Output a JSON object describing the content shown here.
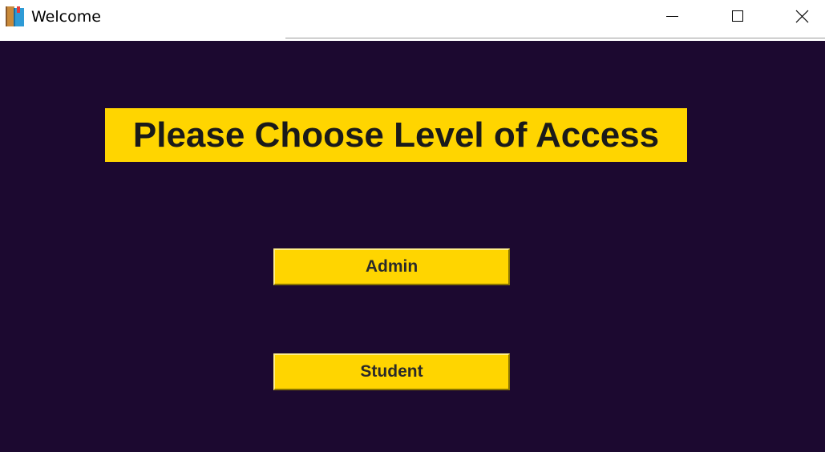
{
  "window": {
    "title": "Welcome",
    "icon": "book-app-icon",
    "controls": [
      "minimize-icon",
      "maximize-icon",
      "close-icon"
    ]
  },
  "main": {
    "heading": "Please Choose Level of Access",
    "buttons": {
      "admin_label": "Admin",
      "student_label": "Student"
    }
  },
  "colors": {
    "background": "#1c0930",
    "accent": "#ffd500",
    "text": "#1a1a1a"
  }
}
